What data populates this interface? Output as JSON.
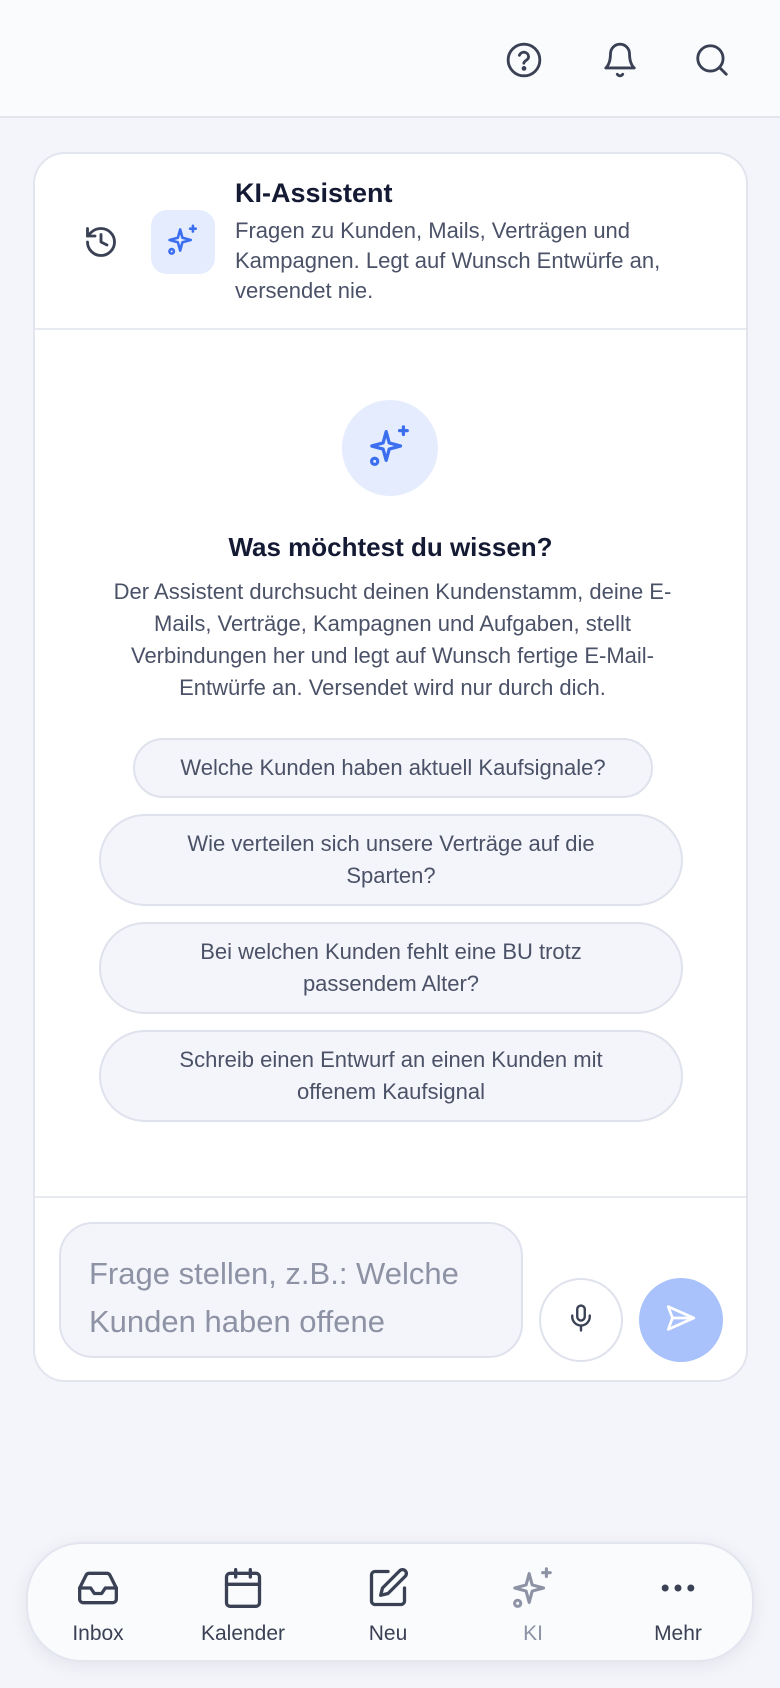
{
  "topbar": {
    "icons": [
      "help-icon",
      "bell-icon",
      "search-icon"
    ]
  },
  "assistant": {
    "title": "KI-Assistent",
    "subtitle": "Fragen zu Kunden, Mails, Verträgen und Kampagnen. Legt auf Wunsch Entwürfe an, versendet nie."
  },
  "empty_state": {
    "heading": "Was möchtest du wissen?",
    "description": "Der Assistent durchsucht deinen Kundenstamm, deine E-Mails, Verträge, Kampagnen und Aufgaben, stellt Verbindungen her und legt auf Wunsch fertige E-Mail-Entwürfe an. Versendet wird nur durch dich.",
    "suggestions": [
      "Welche Kunden haben aktuell Kaufsignale?",
      "Wie verteilen sich unsere Verträge auf die Sparten?",
      "Bei welchen Kunden fehlt eine BU trotz passendem Alter?",
      "Schreib einen Entwurf an einen Kunden mit offenem Kaufsignal"
    ]
  },
  "composer": {
    "placeholder": "Frage stellen, z.B.: Welche Kunden haben offene Kaufsignale?"
  },
  "colors": {
    "accent": "#3b6ff0",
    "accent_soft": "#e5ecfe",
    "send_disabled": "#a9c2fc"
  },
  "bottom_nav": {
    "items": [
      {
        "label": "Inbox",
        "icon": "inbox-icon"
      },
      {
        "label": "Kalender",
        "icon": "calendar-icon"
      },
      {
        "label": "Neu",
        "icon": "compose-icon"
      },
      {
        "label": "KI",
        "icon": "sparkles-icon",
        "active": true
      },
      {
        "label": "Mehr",
        "icon": "more-icon"
      }
    ]
  }
}
